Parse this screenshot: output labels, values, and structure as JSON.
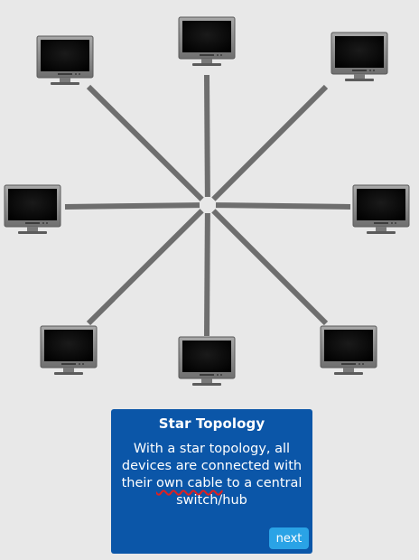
{
  "diagram": {
    "nodes": [
      {
        "id": "monitor-top-left",
        "icon": "monitor-icon"
      },
      {
        "id": "monitor-top",
        "icon": "monitor-icon"
      },
      {
        "id": "monitor-top-right",
        "icon": "monitor-icon"
      },
      {
        "id": "monitor-left",
        "icon": "monitor-icon"
      },
      {
        "id": "monitor-right",
        "icon": "monitor-icon"
      },
      {
        "id": "monitor-bottom-left",
        "icon": "monitor-icon"
      },
      {
        "id": "monitor-bottom",
        "icon": "monitor-icon"
      },
      {
        "id": "monitor-bottom-right",
        "icon": "monitor-icon"
      }
    ],
    "hub": {
      "icon": "hub-icon"
    },
    "colors": {
      "background": "#e8e8e8",
      "cable": "#6e6e6e",
      "monitor_bezel": "#8a8a8a",
      "monitor_screen": "#050505"
    }
  },
  "card": {
    "title": "Star Topology",
    "body_before": "With a star topology, all devices are connected with their ",
    "body_underlined": "own cable",
    "body_after": " to a central switch/hub",
    "next_label": "next",
    "colors": {
      "background": "#0b56a8",
      "button": "#2aa3e6",
      "underline": "#e02020"
    }
  }
}
